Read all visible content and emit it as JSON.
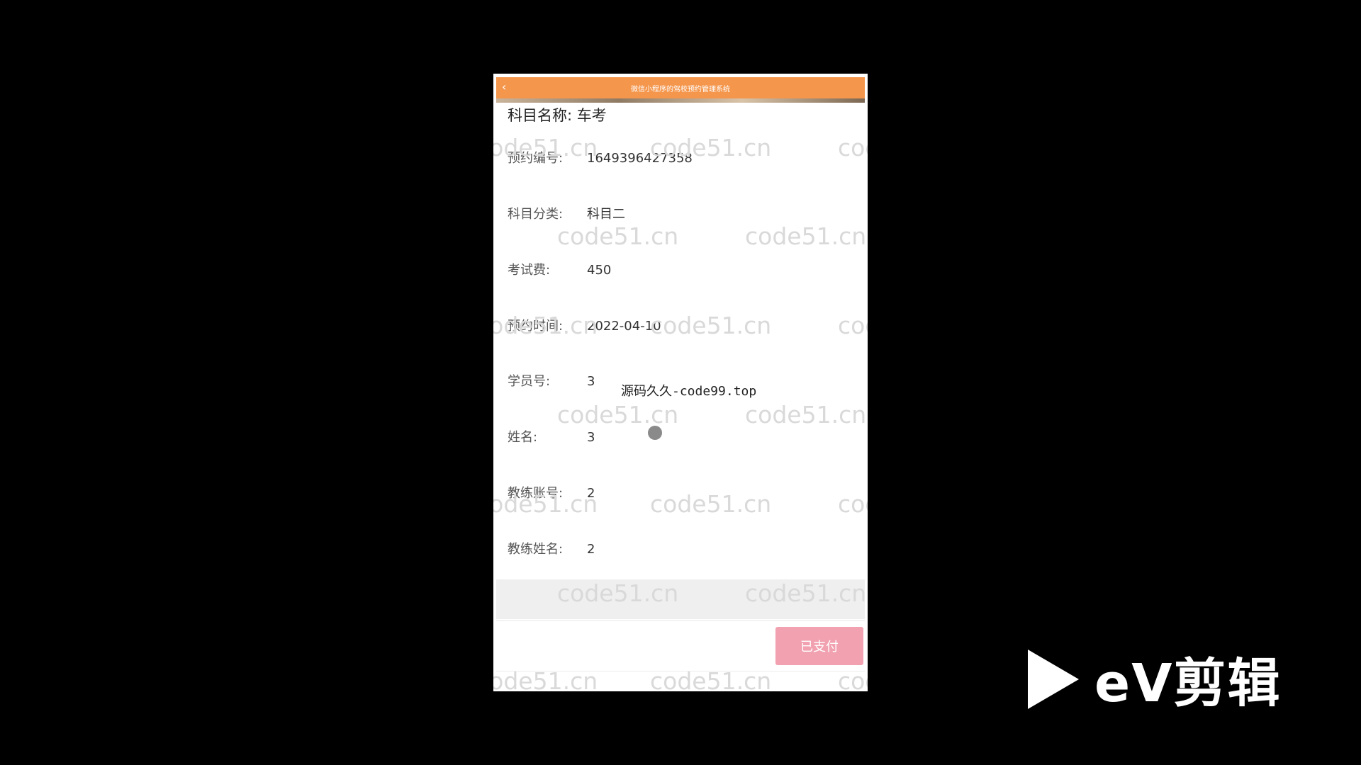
{
  "header": {
    "title": "微信小程序的驾校预约管理系统",
    "back_icon": "‹"
  },
  "detail": {
    "subject_name_label": "科目名称:",
    "subject_name_value": "车考",
    "fields": [
      {
        "label": "预约编号:",
        "value": "1649396427358"
      },
      {
        "label": "科目分类:",
        "value": "科目二"
      },
      {
        "label": "考试费:",
        "value": "450"
      },
      {
        "label": "预约时间:",
        "value": "2022-04-10"
      },
      {
        "label": "学员号:",
        "value": "3"
      },
      {
        "label": "姓名:",
        "value": "3"
      },
      {
        "label": "教练账号:",
        "value": "2"
      },
      {
        "label": "教练姓名:",
        "value": "2"
      }
    ]
  },
  "footer": {
    "pay_button": "已支付"
  },
  "watermark": {
    "text": "code51.cn",
    "overlay_text": "源码久久-code99.top"
  },
  "brand": {
    "logo_text": "eV剪辑"
  },
  "colors": {
    "header": "#f4964c",
    "pay_button": "#f1a1b0"
  }
}
